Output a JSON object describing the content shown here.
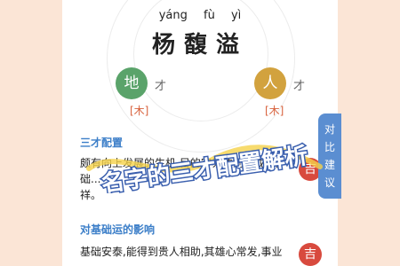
{
  "header": {
    "pinyin": "yáng fù yì",
    "name": "杨馥溢"
  },
  "sancai": {
    "di": {
      "char": "地",
      "cai": "才",
      "element": "[木]",
      "color": "#5aa36a"
    },
    "ren": {
      "char": "人",
      "cai": "才",
      "element": "[木]",
      "color": "#d2a23e"
    }
  },
  "sections": {
    "config_title": "三才配置",
    "config_line1": "颇有向上发展的生机,目的容易达到而成功,",
    "config_line2": "础...",
    "config_line3": "祥。",
    "config_badge": "吉",
    "foundation_title": "对基础运的影响",
    "foundation_line1": "基础安泰,能得到贵人相助,其雄心常发,事业",
    "foundation_badge": "吉"
  },
  "side_tab": [
    "对",
    "比",
    "建",
    "议"
  ],
  "overlay_text": "名字的三才配置解析"
}
